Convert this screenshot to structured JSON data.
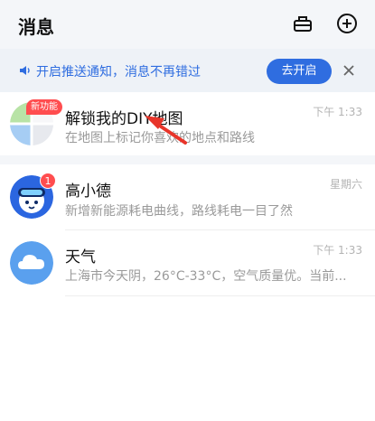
{
  "header": {
    "title": "消息",
    "icons": [
      "toolbox-icon",
      "add-circle-icon"
    ]
  },
  "notice": {
    "text": "开启推送通知，消息不再错过",
    "button_label": "去开启",
    "icons": [
      "speaker-icon",
      "close-icon"
    ]
  },
  "messages": [
    {
      "name": "解锁我的DIY地图",
      "time": "下午 1:33",
      "desc": "在地图上标记你喜欢的地点和路线",
      "tag": "新功能",
      "icon": "diy-map-avatar"
    },
    {
      "name": "高小德",
      "time": "星期六",
      "desc": "新增新能源耗电曲线，路线耗电一目了然",
      "badge": "1",
      "icon": "gaoxiaode-avatar"
    },
    {
      "name": "天气",
      "time": "下午 1:33",
      "desc": "上海市今天阴，26°C-33°C，空气质量优。当前...",
      "icon": "cloud-avatar"
    }
  ],
  "colors": {
    "accent": "#2f6de0",
    "badge": "#ff4d4f",
    "arrow": "#e8352a",
    "weather": "#5aa0ee"
  }
}
